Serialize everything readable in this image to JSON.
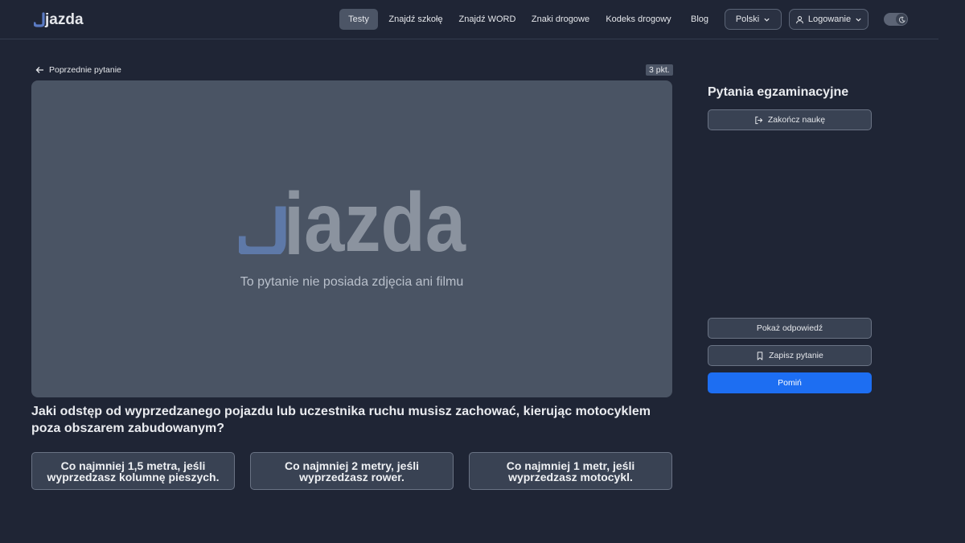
{
  "header": {
    "logo_text": "jazda",
    "nav": [
      {
        "label": "Testy",
        "active": true
      },
      {
        "label": "Znajdź szkołę",
        "active": false
      },
      {
        "label": "Znajdź WORD",
        "active": false
      },
      {
        "label": "Znaki drogowe",
        "active": false
      },
      {
        "label": "Kodeks drogowy",
        "active": false
      },
      {
        "label": "Blog",
        "active": false
      }
    ],
    "language_label": "Polski",
    "login_label": "Logowanie",
    "theme_toggle_icon": "moon-icon"
  },
  "question_view": {
    "back_label": "Poprzednie pytanie",
    "points": "3 pkt.",
    "media_logo_text": "jazda",
    "no_media_text": "To pytanie nie posiada zdjęcia ani filmu",
    "question_text": "Jaki odstęp od wyprzedzanego pojazdu lub uczestnika ruchu musisz zachować, kierując motocyklem poza obszarem zabudowanym?",
    "answers": [
      "Co najmniej 1,5 metra, jeśli wyprzedzasz kolumnę pieszych.",
      "Co najmniej 2 metry, jeśli wyprzedzasz rower.",
      "Co najmniej 1 metr, jeśli wyprzedzasz motocykl."
    ]
  },
  "sidebar": {
    "title": "Pytania egzaminacyjne",
    "finish_label": "Zakończ naukę",
    "show_answer_label": "Pokaż odpowiedź",
    "save_label": "Zapisz pytanie",
    "skip_label": "Pomiń"
  },
  "colors": {
    "background": "#1f2535",
    "accent": "#1d6ef2",
    "logo_accent": "#5b7bc4"
  }
}
